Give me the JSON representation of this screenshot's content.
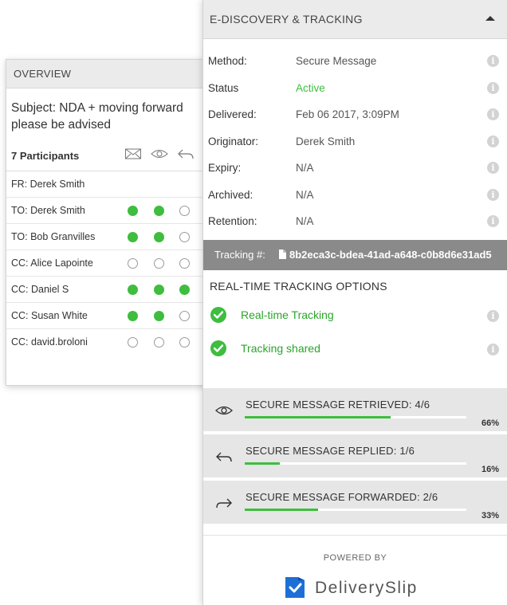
{
  "overview": {
    "title": "OVERVIEW",
    "subject": "Subject: NDA + moving forward\nplease be advised",
    "participants_label": "7 Participants",
    "participants": [
      {
        "name": "FR:  Derek Smith",
        "status": []
      },
      {
        "name": "TO:  Derek Smith",
        "status": [
          "on",
          "on",
          "off"
        ]
      },
      {
        "name": "TO:  Bob Granvilles",
        "status": [
          "on",
          "on",
          "off"
        ]
      },
      {
        "name": "CC:  Alice Lapointe",
        "status": [
          "off",
          "off",
          "off"
        ]
      },
      {
        "name": "CC:  Daniel S",
        "status": [
          "on",
          "on",
          "on"
        ]
      },
      {
        "name": "CC:  Susan White",
        "status": [
          "on",
          "on",
          "off"
        ]
      },
      {
        "name": "CC:  david.broloni",
        "status": [
          "off",
          "off",
          "off"
        ]
      }
    ]
  },
  "ediscovery": {
    "title": "E-DISCOVERY & TRACKING",
    "fields": [
      {
        "label": "Method:",
        "value": "Secure Message"
      },
      {
        "label": "Status",
        "value": "Active"
      },
      {
        "label": "Delivered:",
        "value": "Feb 06 2017, 3:09PM"
      },
      {
        "label": "Originator:",
        "value": "Derek Smith"
      },
      {
        "label": "Expiry:",
        "value": "N/A"
      },
      {
        "label": "Archived:",
        "value": "N/A"
      },
      {
        "label": "Retention:",
        "value": "N/A"
      }
    ],
    "tracking_label": "Tracking #:",
    "tracking_number": "8b2eca3c-bdea-41ad-a648-c0b8d6e31ad5",
    "realtime_title": "REAL-TIME TRACKING OPTIONS",
    "realtime_options": [
      {
        "label": "Real-time Tracking"
      },
      {
        "label": "Tracking shared"
      }
    ],
    "stats": [
      {
        "label": "SECURE MESSAGE RETRIEVED:  4/6",
        "percent": 66,
        "percent_label": "66%",
        "icon": "eye-icon"
      },
      {
        "label": "SECURE MESSAGE REPLIED:  1/6",
        "percent": 16,
        "percent_label": "16%",
        "icon": "reply-icon"
      },
      {
        "label": "SECURE MESSAGE FORWARDED:  2/6",
        "percent": 33,
        "percent_label": "33%",
        "icon": "forward-icon"
      }
    ],
    "powered_by": "POWERED BY",
    "brand_name": "DeliverySlip"
  },
  "colors": {
    "accent_green": "#3ebd3e",
    "header_grey": "#ebebeb",
    "tracking_bar": "#8a8a8a",
    "brand_blue": "#1d6fd8"
  }
}
